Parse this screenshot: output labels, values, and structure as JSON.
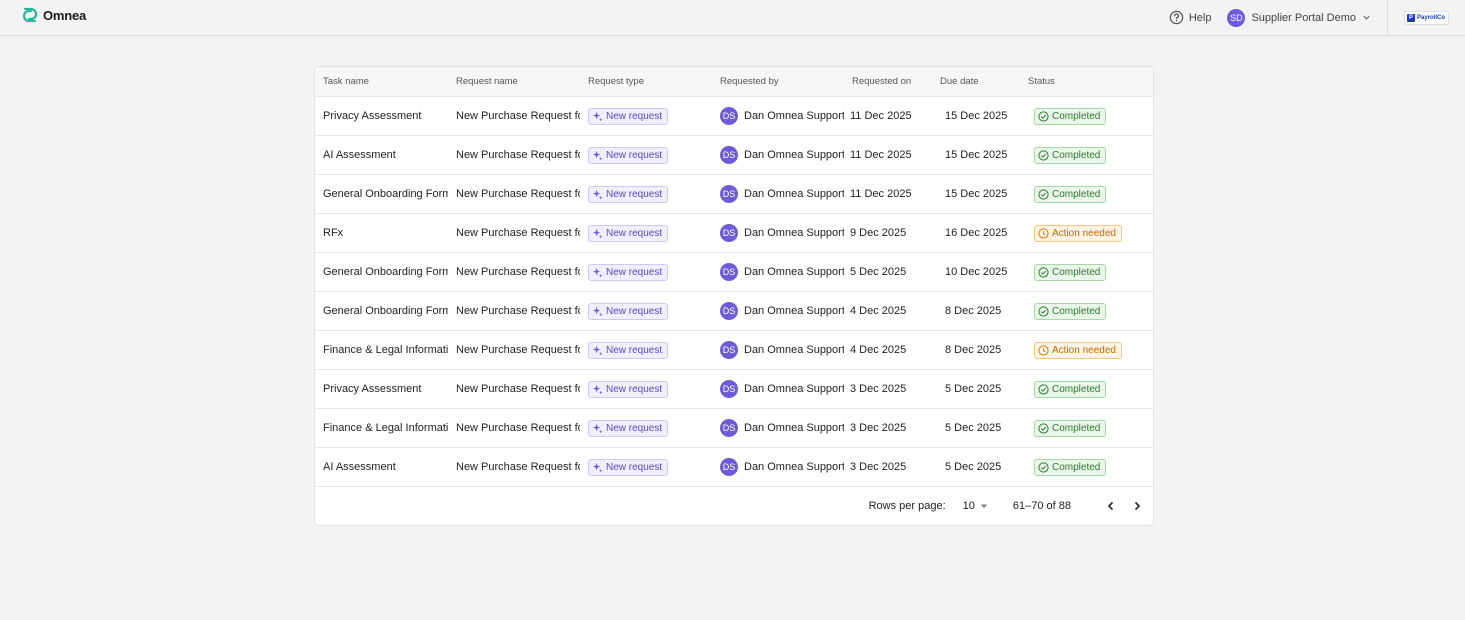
{
  "brand": {
    "name": "Omnea",
    "accent": "#2bb59a"
  },
  "topbar": {
    "help_label": "Help",
    "user_initials": "SD",
    "user_name": "Supplier Portal Demo",
    "org_logo_text": "PayrollCo"
  },
  "table": {
    "columns": [
      "Task name",
      "Request name",
      "Request type",
      "Requested by",
      "Requested on",
      "Due date",
      "Status"
    ],
    "rows": [
      {
        "task": "Privacy Assessment",
        "request": "New Purchase Request fo",
        "type": "New request",
        "initials": "DS",
        "by": "Dan Omnea Support",
        "requested_on": "11 Dec 2025",
        "due": "15 Dec 2025",
        "status": "Completed",
        "status_kind": "completed"
      },
      {
        "task": "AI Assessment",
        "request": "New Purchase Request fo",
        "type": "New request",
        "initials": "DS",
        "by": "Dan Omnea Support",
        "requested_on": "11 Dec 2025",
        "due": "15 Dec 2025",
        "status": "Completed",
        "status_kind": "completed"
      },
      {
        "task": "General Onboarding Form",
        "request": "New Purchase Request fo",
        "type": "New request",
        "initials": "DS",
        "by": "Dan Omnea Support",
        "requested_on": "11 Dec 2025",
        "due": "15 Dec 2025",
        "status": "Completed",
        "status_kind": "completed"
      },
      {
        "task": "RFx",
        "request": "New Purchase Request fo",
        "type": "New request",
        "initials": "DS",
        "by": "Dan Omnea Support",
        "requested_on": "9 Dec 2025",
        "due": "16 Dec 2025",
        "status": "Action needed",
        "status_kind": "action"
      },
      {
        "task": "General Onboarding Form",
        "request": "New Purchase Request fo",
        "type": "New request",
        "initials": "DS",
        "by": "Dan Omnea Support",
        "requested_on": "5 Dec 2025",
        "due": "10 Dec 2025",
        "status": "Completed",
        "status_kind": "completed"
      },
      {
        "task": "General Onboarding Form",
        "request": "New Purchase Request fo",
        "type": "New request",
        "initials": "DS",
        "by": "Dan Omnea Support",
        "requested_on": "4 Dec 2025",
        "due": "8 Dec 2025",
        "status": "Completed",
        "status_kind": "completed"
      },
      {
        "task": "Finance & Legal Informatic",
        "request": "New Purchase Request fo",
        "type": "New request",
        "initials": "DS",
        "by": "Dan Omnea Support",
        "requested_on": "4 Dec 2025",
        "due": "8 Dec 2025",
        "status": "Action needed",
        "status_kind": "action"
      },
      {
        "task": "Privacy Assessment",
        "request": "New Purchase Request fo",
        "type": "New request",
        "initials": "DS",
        "by": "Dan Omnea Support",
        "requested_on": "3 Dec 2025",
        "due": "5 Dec 2025",
        "status": "Completed",
        "status_kind": "completed"
      },
      {
        "task": "Finance & Legal Informatic",
        "request": "New Purchase Request fo",
        "type": "New request",
        "initials": "DS",
        "by": "Dan Omnea Support",
        "requested_on": "3 Dec 2025",
        "due": "5 Dec 2025",
        "status": "Completed",
        "status_kind": "completed"
      },
      {
        "task": "AI Assessment",
        "request": "New Purchase Request fo",
        "type": "New request",
        "initials": "DS",
        "by": "Dan Omnea Support",
        "requested_on": "3 Dec 2025",
        "due": "5 Dec 2025",
        "status": "Completed",
        "status_kind": "completed"
      }
    ]
  },
  "pagination": {
    "rows_per_page_label": "Rows per page:",
    "rows_per_page": "10",
    "range": "61–70 of 88"
  },
  "icons": {
    "type_badge": "sparkle-icon",
    "completed": "check-circle-icon",
    "action": "clock-icon",
    "help": "help-circle-icon",
    "dropdown": "chevron-down-icon",
    "prev": "chevron-left-icon",
    "next": "chevron-right-icon"
  }
}
